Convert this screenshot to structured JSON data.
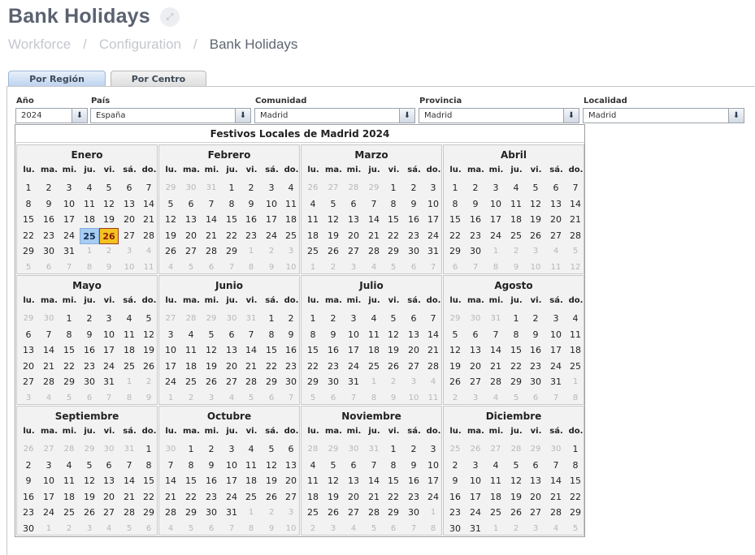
{
  "page": {
    "title": "Bank Holidays",
    "expand_icon": "⤢"
  },
  "breadcrumb": [
    "Workforce",
    "Configuration",
    "Bank Holidays"
  ],
  "breadcrumb_separator": "/",
  "tabs": [
    {
      "label": "Por Región",
      "active": true
    },
    {
      "label": "Por Centro",
      "active": false
    }
  ],
  "filters": [
    {
      "label": "Año",
      "value": "2024"
    },
    {
      "label": "País",
      "value": "España"
    },
    {
      "label": "Comunidad",
      "value": "Madrid"
    },
    {
      "label": "Provincia",
      "value": "Madrid"
    },
    {
      "label": "Localidad",
      "value": "Madrid"
    }
  ],
  "dropdown_icon": "⬇",
  "calendar": {
    "title": "Festivos Locales de Madrid 2024",
    "weekdays": [
      "lu.",
      "ma.",
      "mi.",
      "ju.",
      "vi.",
      "sá.",
      "do."
    ],
    "months": [
      "Enero",
      "Febrero",
      "Marzo",
      "Abril",
      "Mayo",
      "Junio",
      "Julio",
      "Agosto",
      "Septiembre",
      "Octubre",
      "Noviembre",
      "Diciembre"
    ],
    "year": 2024,
    "today": {
      "month": 0,
      "day": 25
    },
    "holidays": [
      {
        "month": 0,
        "day": 26
      }
    ],
    "colors": {
      "today": "#a8cbf0",
      "holiday": "#f4c221",
      "holiday_text": "#8c1c00"
    }
  }
}
